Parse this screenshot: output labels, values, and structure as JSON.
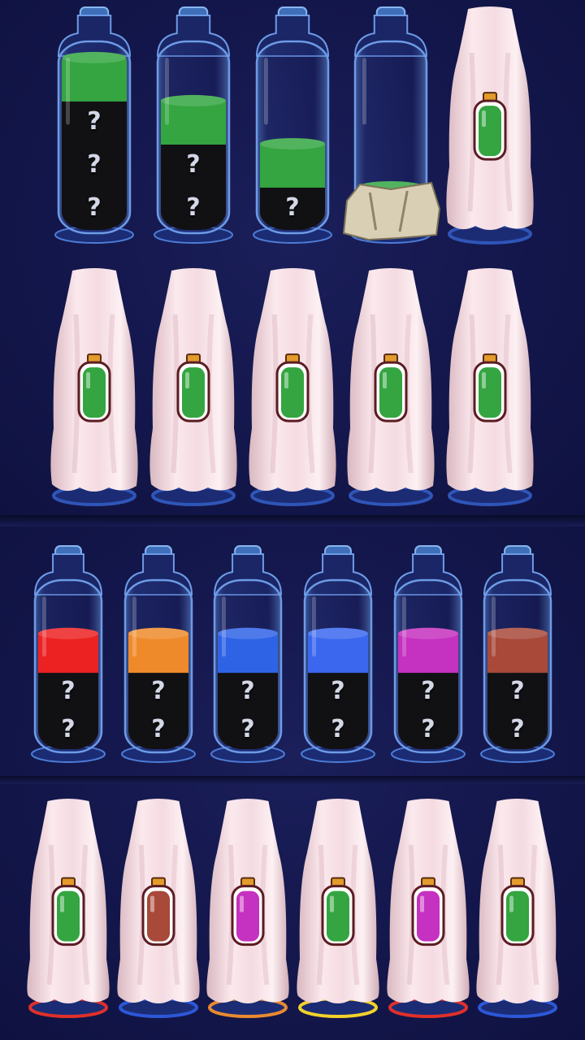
{
  "game": {
    "hidden_symbol": "?",
    "colors": {
      "green": "#34a541",
      "red": "#ec2222",
      "orange": "#ef8a2a",
      "blue": "#2f63e6",
      "blue_alt": "#3a67ee",
      "magenta": "#c531c0",
      "brown": "#a8493a",
      "unknown": "#111114",
      "cloth": "#f3dbe0",
      "rock": "#d8cfb4"
    },
    "row1": [
      {
        "cover": false,
        "layers": [
          "green",
          "unknown",
          "unknown",
          "unknown"
        ]
      },
      {
        "cover": false,
        "layers": [
          "green",
          "unknown",
          "unknown"
        ]
      },
      {
        "cover": false,
        "layers": [
          "green",
          "unknown"
        ]
      },
      {
        "cover": false,
        "locked_by": "rock",
        "layers": [
          "green"
        ]
      },
      {
        "cover": true,
        "hint_color": "green"
      }
    ],
    "row2": [
      {
        "cover": true,
        "hint_color": "green"
      },
      {
        "cover": true,
        "hint_color": "green"
      },
      {
        "cover": true,
        "hint_color": "green"
      },
      {
        "cover": true,
        "hint_color": "green"
      },
      {
        "cover": true,
        "hint_color": "green"
      }
    ],
    "row3": [
      {
        "cover": false,
        "layers": [
          "red",
          "unknown",
          "unknown"
        ]
      },
      {
        "cover": false,
        "layers": [
          "orange",
          "unknown",
          "unknown"
        ]
      },
      {
        "cover": false,
        "layers": [
          "blue",
          "unknown",
          "unknown"
        ]
      },
      {
        "cover": false,
        "layers": [
          "blue_alt",
          "unknown",
          "unknown"
        ]
      },
      {
        "cover": false,
        "layers": [
          "magenta",
          "unknown",
          "unknown"
        ]
      },
      {
        "cover": false,
        "layers": [
          "brown",
          "unknown",
          "unknown"
        ]
      }
    ],
    "row4": [
      {
        "cover": true,
        "hint_color": "green",
        "base_color": "red"
      },
      {
        "cover": true,
        "hint_color": "brown",
        "base_color": "blue"
      },
      {
        "cover": true,
        "hint_color": "magenta",
        "base_color": "orange"
      },
      {
        "cover": true,
        "hint_color": "green",
        "base_color": "yellow"
      },
      {
        "cover": true,
        "hint_color": "magenta",
        "base_color": "red"
      },
      {
        "cover": true,
        "hint_color": "green",
        "base_color": "blue"
      }
    ]
  }
}
